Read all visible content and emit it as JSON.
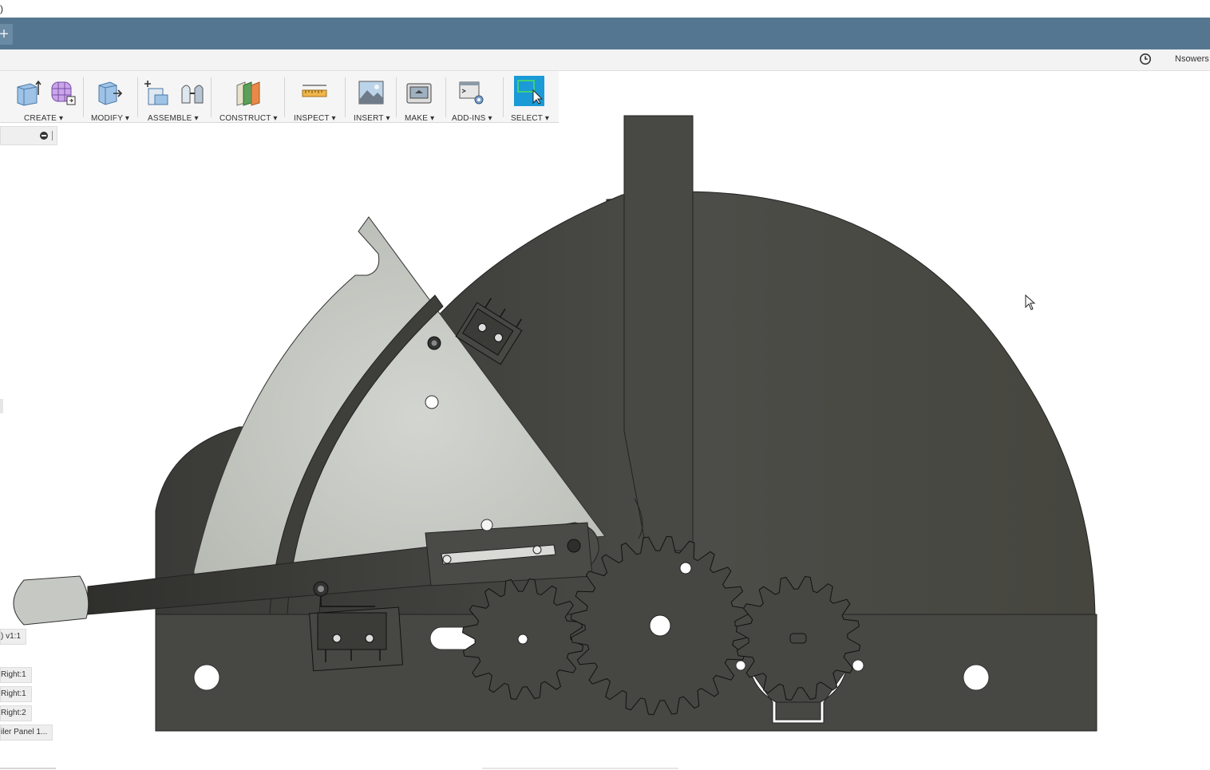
{
  "window": {
    "title_fragment": ")"
  },
  "tabbar": {
    "add_label": "+"
  },
  "qat": {
    "user": "Nsowers",
    "history_icon": "clock-icon"
  },
  "ribbon": {
    "groups": [
      {
        "label": "CREATE ▾",
        "icons": [
          "extrude-icon",
          "form-icon"
        ]
      },
      {
        "label": "MODIFY ▾",
        "icons": [
          "press-pull-icon"
        ]
      },
      {
        "label": "ASSEMBLE ▾",
        "icons": [
          "new-component-icon",
          "joint-icon"
        ]
      },
      {
        "label": "CONSTRUCT ▾",
        "icons": [
          "offset-plane-icon"
        ]
      },
      {
        "label": "INSPECT ▾",
        "icons": [
          "measure-icon"
        ]
      },
      {
        "label": "INSERT ▾",
        "icons": [
          "insert-image-icon"
        ]
      },
      {
        "label": "MAKE ▾",
        "icons": [
          "3d-print-icon"
        ]
      },
      {
        "label": "ADD-INS ▾",
        "icons": [
          "scripts-addins-icon"
        ]
      },
      {
        "label": "SELECT ▾",
        "icons": [
          "select-icon"
        ]
      }
    ],
    "colors": {
      "select_active": "#1a9ad6"
    }
  },
  "browser": {
    "row_icon": "minus-icon"
  },
  "timeline": {
    "items": [
      ") v1:1",
      "Right:1",
      "Right:1",
      "Right:2",
      "iler Panel 1..."
    ]
  },
  "model": {
    "colors": {
      "dark_part": "#4a4a46",
      "light_part": "#c3c5c0",
      "outline": "#222"
    }
  }
}
